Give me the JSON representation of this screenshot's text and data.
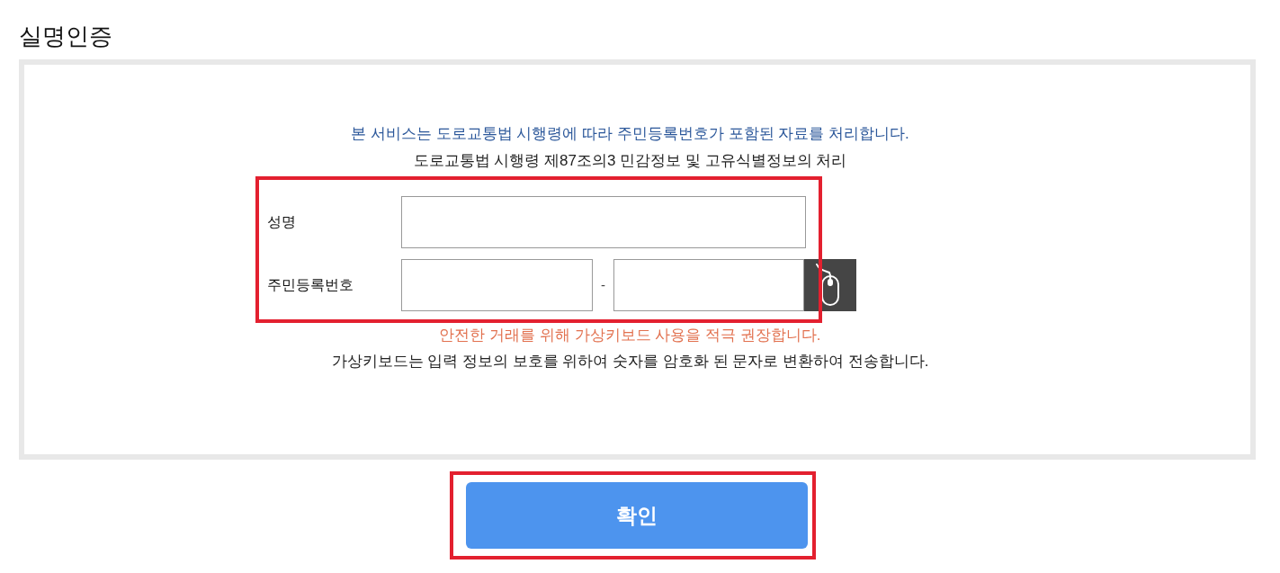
{
  "page": {
    "title": "실명인증"
  },
  "notice": {
    "service_text": "본 서비스는 도로교통법 시행령에 따라 주민등록번호가 포함된 자료를 처리합니다.",
    "law_text": "도로교통법 시행령 제87조의3 민감정보 및 고유식별정보의 처리"
  },
  "form": {
    "highlighted": true,
    "fields": [
      {
        "label": "성명",
        "kind": "single"
      },
      {
        "label": "주민등록번호",
        "kind": "split",
        "separator": "-"
      }
    ]
  },
  "keyboard_notes": {
    "recommend": "안전한 거래를 위해 가상키보드 사용을 적극 권장합니다.",
    "explain": "가상키보드는 입력 정보의 보호를 위하여 숫자를 암호화 된 문자로 변환하여 전송합니다."
  },
  "confirm_button": {
    "label": "확인",
    "highlighted": true
  }
}
